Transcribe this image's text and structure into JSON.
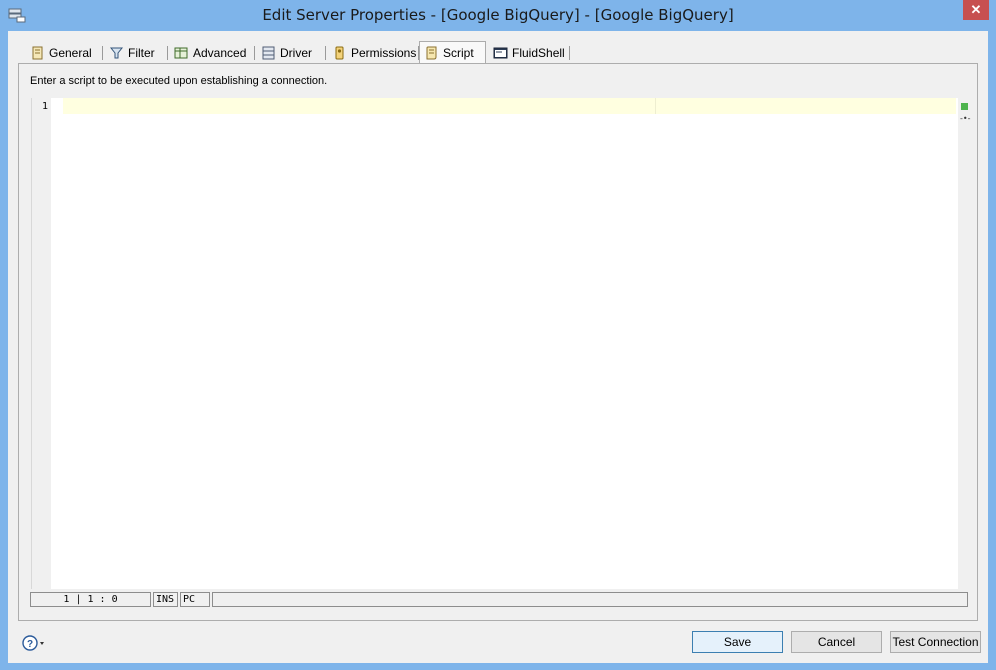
{
  "window": {
    "title": "Edit Server Properties - [Google BigQuery] - [Google BigQuery]",
    "close_label": "✕",
    "accent": "#7eb4ea"
  },
  "tabs": [
    {
      "label": "General",
      "icon": "general-icon"
    },
    {
      "label": "Filter",
      "icon": "filter-icon"
    },
    {
      "label": "Advanced",
      "icon": "advanced-icon"
    },
    {
      "label": "Driver",
      "icon": "driver-icon"
    },
    {
      "label": "Permissions",
      "icon": "permissions-icon"
    },
    {
      "label": "Script",
      "icon": "script-icon",
      "selected": true
    },
    {
      "label": "FluidShell",
      "icon": "fluidshell-icon"
    }
  ],
  "script_panel": {
    "instruction": "Enter a script to be executed upon establishing a connection.",
    "line_numbers": [
      "1"
    ],
    "content": ""
  },
  "status": {
    "position": "1 | 1 : 0",
    "mode": "INS",
    "line_ending": "PC",
    "message": ""
  },
  "footer": {
    "help_icon": "help-icon",
    "save_label": "Save",
    "cancel_label": "Cancel",
    "test_label": "Test Connection"
  }
}
